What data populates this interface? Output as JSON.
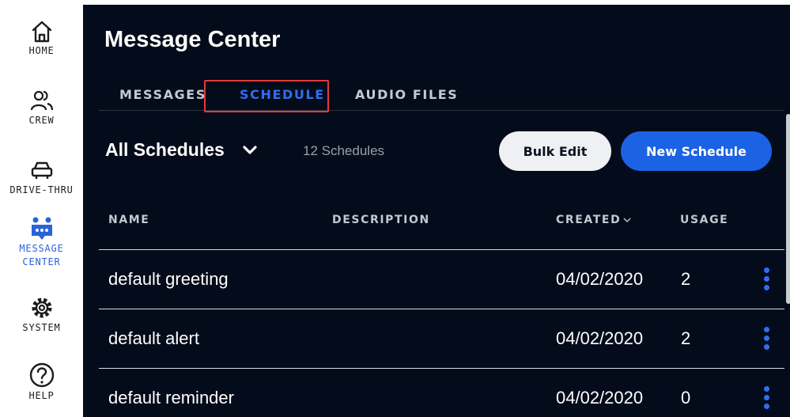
{
  "sidebar": {
    "items": [
      {
        "label": "HOME",
        "icon": "home-icon"
      },
      {
        "label": "CREW",
        "icon": "users-icon"
      },
      {
        "label": "DRIVE-THRU",
        "icon": "car-icon"
      },
      {
        "label": "MESSAGE\nCENTER",
        "icon": "message-center-icon",
        "active": true
      },
      {
        "label": "SYSTEM",
        "icon": "gear-icon"
      },
      {
        "label": "HELP",
        "icon": "help-icon"
      }
    ]
  },
  "main": {
    "title": "Message Center",
    "tabs": [
      {
        "label": "MESSAGES"
      },
      {
        "label": "SCHEDULE",
        "active": true
      },
      {
        "label": "AUDIO FILES"
      }
    ],
    "filter": {
      "label": "All Schedules",
      "icon": "chevron-down-icon"
    },
    "count": "12 Schedules",
    "buttons": {
      "bulk_edit": "Bulk Edit",
      "new_schedule": "New Schedule"
    },
    "table": {
      "columns": [
        "NAME",
        "DESCRIPTION",
        "CREATED",
        "USAGE"
      ],
      "rows": [
        {
          "name": "default greeting",
          "description": "",
          "created": "04/02/2020",
          "usage": "2"
        },
        {
          "name": "default alert",
          "description": "",
          "created": "04/02/2020",
          "usage": "2"
        },
        {
          "name": "default reminder",
          "description": "",
          "created": "04/02/2020",
          "usage": "0"
        }
      ]
    }
  },
  "colors": {
    "panel_bg": "#040b1a",
    "accent": "#1b62e5",
    "active_nav": "#2a63d9",
    "highlight": "#e23b3b"
  }
}
